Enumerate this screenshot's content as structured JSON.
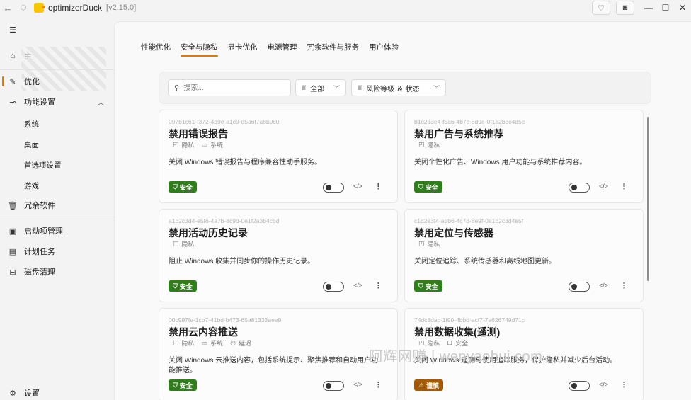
{
  "app": {
    "title": "optimizerDuck",
    "version": "[v2.15.0]"
  },
  "sidebar": {
    "menu_icon": "hamburger-icon",
    "home_label": "主",
    "items": [
      {
        "label": "优化",
        "icon": "broom-icon"
      },
      {
        "label": "功能设置",
        "icon": "toggle-icon"
      },
      {
        "label": "冗余软件",
        "icon": "trash-icon"
      },
      {
        "label": "启动项管理",
        "icon": "startup-icon"
      },
      {
        "label": "计划任务",
        "icon": "calendar-icon"
      },
      {
        "label": "磁盘清理",
        "icon": "disk-icon"
      },
      {
        "label": "设置",
        "icon": "gear-icon"
      }
    ],
    "subitems": [
      "系统",
      "桌面",
      "首选项设置",
      "游戏"
    ]
  },
  "tabs": [
    "性能优化",
    "安全与隐私",
    "显卡优化",
    "电源管理",
    "冗余软件与服务",
    "用户体验"
  ],
  "filters": {
    "search_placeholder": "搜索...",
    "category": "全部",
    "risk": "风险等级 ＆ 状态"
  },
  "cards": [
    {
      "uid": "097b1c61-f372-4b9e-a1c9-d5a6f7a8b9c0",
      "title": "禁用错误报告",
      "tags": [
        "隐私",
        "系统"
      ],
      "desc": "关闭 Windows 错误报告与程序兼容性助手服务。",
      "badge": "安全"
    },
    {
      "uid": "b1c2d3e4-f5a6-4b7c-8d9e-0f1a2b3c4d5e",
      "title": "禁用广告与系统推荐",
      "tags": [
        "隐私"
      ],
      "desc": "关闭个性化广告、Windows 用户功能与系统推荐内容。",
      "badge": "安全"
    },
    {
      "uid": "a1b2c3d4-e5f6-4a7b-8c9d-0e1f2a3b4c5d",
      "title": "禁用活动历史记录",
      "tags": [
        "隐私"
      ],
      "desc": "阻止 Windows 收集并同步你的操作历史记录。",
      "badge": "安全"
    },
    {
      "uid": "c1d2e3f4-a5b6-4c7d-8e9f-0a1b2c3d4e5f",
      "title": "禁用定位与传感器",
      "tags": [
        "隐私"
      ],
      "desc": "关闭定位追踪、系统传感器和离线地图更新。",
      "badge": "安全"
    },
    {
      "uid": "00c997fe-1cb7-41bd-b473-65a81333aee9",
      "title": "禁用云内容推送",
      "tags": [
        "隐私",
        "系统",
        "延迟"
      ],
      "desc": "关闭 Windows 云推送内容，包括系统提示、聚焦推荐和自动用户功能推送。",
      "badge": "安全"
    },
    {
      "uid": "74dc8dac-1f90-4bbd-acf7-7e626749d71c",
      "title": "禁用数据收集(遥测)",
      "tags": [
        "隐私",
        "安全"
      ],
      "desc": "关闭 Windows 遥测与使用追踪服务，保护隐私并减少后台活动。",
      "badge": "谨慎"
    }
  ],
  "watermark": "阿辉网赚 | wenyaohui.com",
  "colors": {
    "accent": "#e07a00",
    "safe": "#2f7d1b",
    "caution": "#a35a00"
  }
}
